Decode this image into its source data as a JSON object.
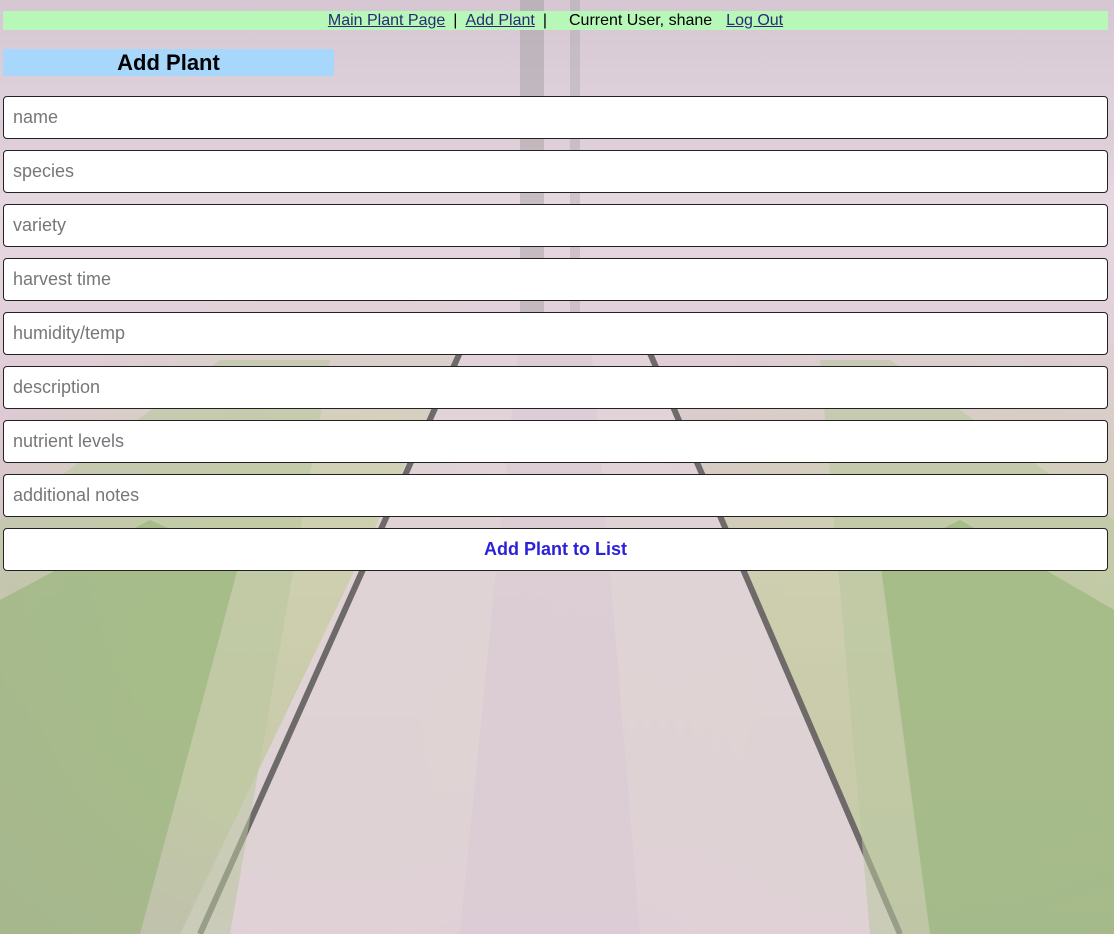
{
  "nav": {
    "main_link": "Main Plant Page",
    "add_link": "Add Plant",
    "separator": "|",
    "current_user_label": "Current User, shane",
    "logout_link": "Log Out"
  },
  "page": {
    "title": "Add Plant"
  },
  "form": {
    "fields": [
      {
        "placeholder": "name",
        "value": ""
      },
      {
        "placeholder": "species",
        "value": ""
      },
      {
        "placeholder": "variety",
        "value": ""
      },
      {
        "placeholder": "harvest time",
        "value": ""
      },
      {
        "placeholder": "humidity/temp",
        "value": ""
      },
      {
        "placeholder": "description",
        "value": ""
      },
      {
        "placeholder": "nutrient levels",
        "value": ""
      },
      {
        "placeholder": "additional notes",
        "value": ""
      }
    ],
    "submit_label": "Add Plant to List"
  },
  "colors": {
    "nav_bg": "#b7f7b8",
    "title_bg": "#a7d7fb",
    "submit_text": "#2c21db",
    "link": "#2a2a74"
  }
}
